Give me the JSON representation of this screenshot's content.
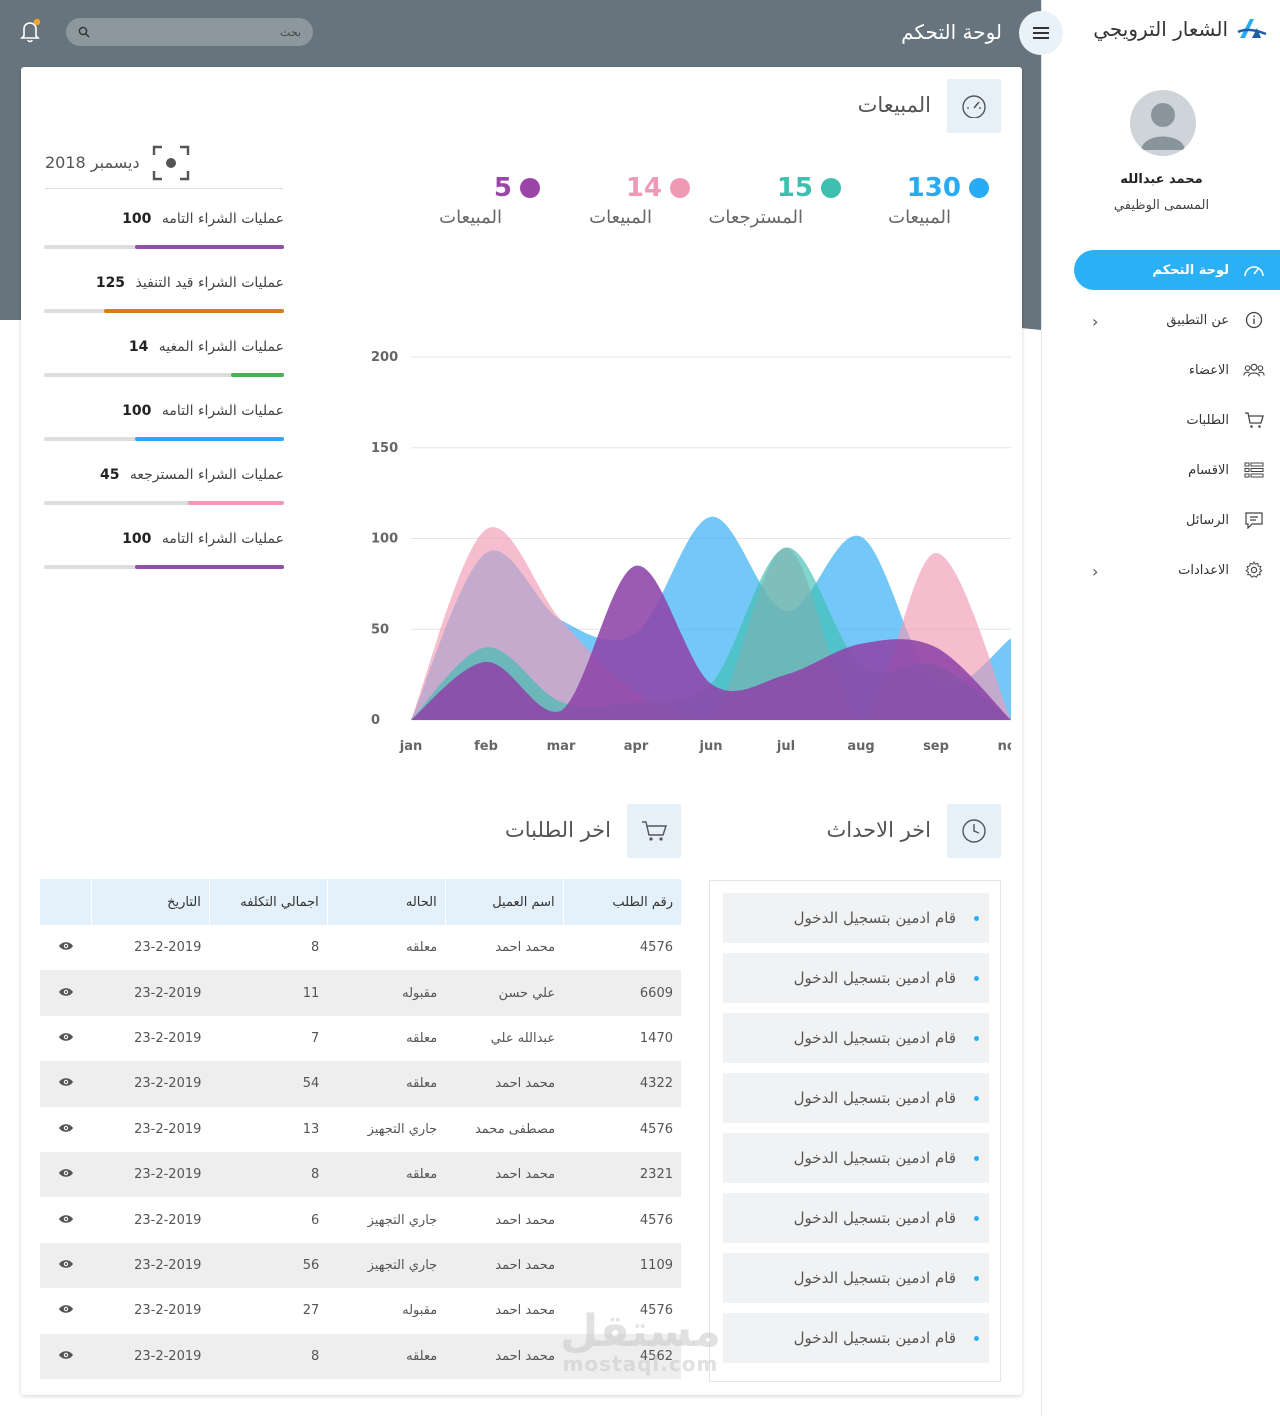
{
  "brand": {
    "name": "الشعار الترويجي"
  },
  "header": {
    "title": "لوحة التحكم",
    "search_placeholder": "بحث"
  },
  "user": {
    "name": "محمد عبدالله",
    "role": "المسمى الوظيفي"
  },
  "sidebar": {
    "items": [
      {
        "label": "لوحة التحكم",
        "icon": "speedometer-icon",
        "active": true
      },
      {
        "label": "عن التطبيق",
        "icon": "info-icon",
        "has_submenu": true
      },
      {
        "label": "الاعضاء",
        "icon": "users-icon"
      },
      {
        "label": "الطلبات",
        "icon": "cart-icon"
      },
      {
        "label": "الاقسام",
        "icon": "list-icon"
      },
      {
        "label": "الرسائل",
        "icon": "message-icon"
      },
      {
        "label": "الاعدادات",
        "icon": "gear-icon",
        "has_submenu": true
      }
    ]
  },
  "sales": {
    "title": "المبيعات",
    "stats": [
      {
        "value": "130",
        "label": "المبيعات",
        "color": "#29aaf4"
      },
      {
        "value": "15",
        "label": "المسترجعات",
        "color": "#3ebfb0"
      },
      {
        "value": "14",
        "label": "المبيعات",
        "color": "#ef9ab4"
      },
      {
        "value": "5",
        "label": "المبيعات",
        "color": "#9b45a8"
      }
    ],
    "month": "ديسمبر 2018",
    "progress": [
      {
        "label": "عمليات الشراء التامه",
        "value": "100",
        "fraction": 0.62,
        "color": "#8e4fae"
      },
      {
        "label": "عمليات الشراء قيد التنفيذ",
        "value": "125",
        "fraction": 0.75,
        "color": "#d4801a"
      },
      {
        "label": "عمليات الشراء المغيه",
        "value": "14",
        "fraction": 0.22,
        "color": "#4caf50"
      },
      {
        "label": "عمليات الشراء التامه",
        "value": "100",
        "fraction": 0.62,
        "color": "#29aaf4"
      },
      {
        "label": "عمليات الشراء المسترجعه",
        "value": "45",
        "fraction": 0.4,
        "color": "#ef9ab4"
      },
      {
        "label": "عمليات الشراء التامه",
        "value": "100",
        "fraction": 0.62,
        "color": "#8e4fae"
      }
    ]
  },
  "chart_data": {
    "type": "area",
    "x": [
      "jan",
      "feb",
      "mar",
      "apr",
      "jun",
      "jul",
      "aug",
      "sep",
      "nov"
    ],
    "ylim": [
      0,
      200
    ],
    "yticks": [
      0,
      50,
      100,
      150,
      200
    ],
    "grid": true,
    "series": [
      {
        "values": [
          0,
          92,
          55,
          48,
          112,
          60,
          101,
          20,
          45
        ],
        "color": "#29aaf4"
      },
      {
        "values": [
          0,
          105,
          55,
          15,
          0,
          95,
          0,
          92,
          0
        ],
        "color": "#ef9ab4"
      },
      {
        "values": [
          0,
          40,
          10,
          10,
          20,
          95,
          30,
          30,
          0
        ],
        "color": "#3ebfb0"
      },
      {
        "values": [
          0,
          32,
          5,
          85,
          20,
          25,
          42,
          40,
          0
        ],
        "color": "#8e44a8"
      }
    ]
  },
  "events": {
    "title": "اخر الاحداث",
    "items": [
      "قام ادمين بتسجيل الدخول",
      "قام ادمين بتسجيل الدخول",
      "قام ادمين بتسجيل الدخول",
      "قام ادمين بتسجيل الدخول",
      "قام ادمين بتسجيل الدخول",
      "قام ادمين بتسجيل الدخول",
      "قام ادمين بتسجيل الدخول",
      "قام ادمين بتسجيل الدخول"
    ]
  },
  "orders": {
    "title": "اخر الطلبات",
    "columns": [
      "رقم الطلب",
      "اسم العميل",
      "الحاله",
      "اجمالي التكلفه",
      "التاريخ"
    ],
    "rows": [
      [
        "4576",
        "محمد احمد",
        "معلقه",
        "8",
        "23-2-2019"
      ],
      [
        "6609",
        "علي حسن",
        "مقبوله",
        "11",
        "23-2-2019"
      ],
      [
        "1470",
        "عبدالله علي",
        "معلقه",
        "7",
        "23-2-2019"
      ],
      [
        "4322",
        "محمد احمد",
        "معلقه",
        "54",
        "23-2-2019"
      ],
      [
        "4576",
        "مصطفى محمد",
        "جاري التجهيز",
        "13",
        "23-2-2019"
      ],
      [
        "2321",
        "محمد احمد",
        "معلقه",
        "8",
        "23-2-2019"
      ],
      [
        "4576",
        "محمد احمد",
        "جاري التجهيز",
        "6",
        "23-2-2019"
      ],
      [
        "1109",
        "محمد احمد",
        "جاري التجهيز",
        "56",
        "23-2-2019"
      ],
      [
        "4576",
        "محمد احمد",
        "مقبوله",
        "27",
        "23-2-2019"
      ],
      [
        "4562",
        "محمد احمد",
        "معلقه",
        "8",
        "23-2-2019"
      ]
    ]
  },
  "watermark": {
    "arabic": "مستقل",
    "latin": "mostaql.com"
  }
}
